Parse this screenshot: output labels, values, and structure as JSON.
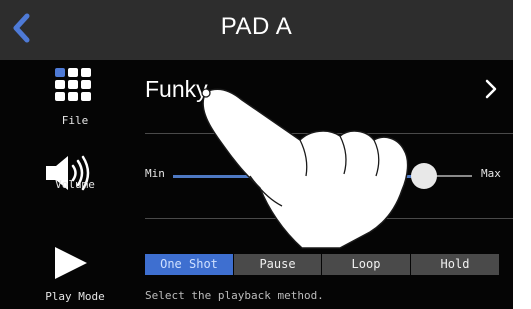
{
  "header": {
    "title": "PAD A"
  },
  "file_row": {
    "label": "File",
    "value": "Funky"
  },
  "volume_row": {
    "label": "Volume",
    "min_label": "Min",
    "max_label": "Max",
    "level": 0.84
  },
  "play_mode_row": {
    "label": "Play Mode",
    "options": [
      "One Shot",
      "Pause",
      "Loop",
      "Hold"
    ],
    "selected_index": 0,
    "hint": "Select the playback method."
  },
  "colors": {
    "accent": "#3e6fd0",
    "header_bg": "#2d2d2d",
    "background": "#050505"
  },
  "icons": [
    "back-chevron-icon",
    "file-grid-icon",
    "speaker-icon",
    "play-icon",
    "chevron-right-icon",
    "pointing-hand-icon"
  ]
}
